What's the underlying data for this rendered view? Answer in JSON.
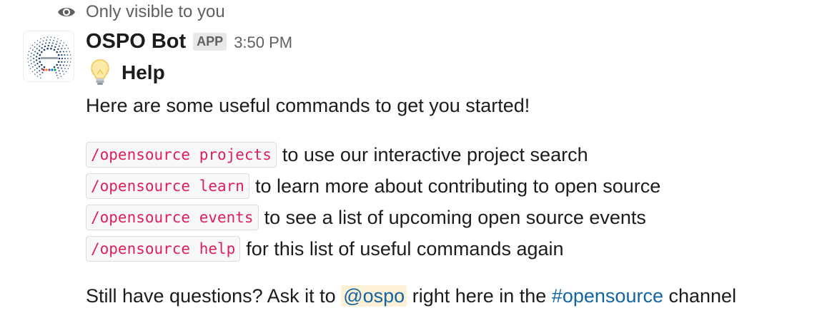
{
  "visibility": {
    "icon": "eye-icon",
    "label": "Only visible to you"
  },
  "message": {
    "avatar": "comcast-logo-avatar",
    "author": "OSPO Bot",
    "badge": "APP",
    "time": "3:50 PM",
    "heading_icon": "lightbulb-icon",
    "heading": "Help",
    "intro": "Here are some useful commands to get you started!",
    "commands": [
      {
        "command": "/opensource projects",
        "description": "to use our interactive project search"
      },
      {
        "command": "/opensource learn",
        "description": "to learn more about contributing to open source"
      },
      {
        "command": "/opensource events",
        "description": "to see a list of upcoming open source events"
      },
      {
        "command": "/opensource help",
        "description": "for this list of useful commands again"
      }
    ],
    "footer": {
      "prefix": "Still have questions? Ask it to",
      "mention": "@ospo",
      "middle": "right here in the",
      "channel": "#opensource",
      "suffix": "channel"
    }
  },
  "colors": {
    "code_text": "#e01e5a",
    "link": "#1264a3",
    "mention_bg": "#fcf1d6"
  }
}
